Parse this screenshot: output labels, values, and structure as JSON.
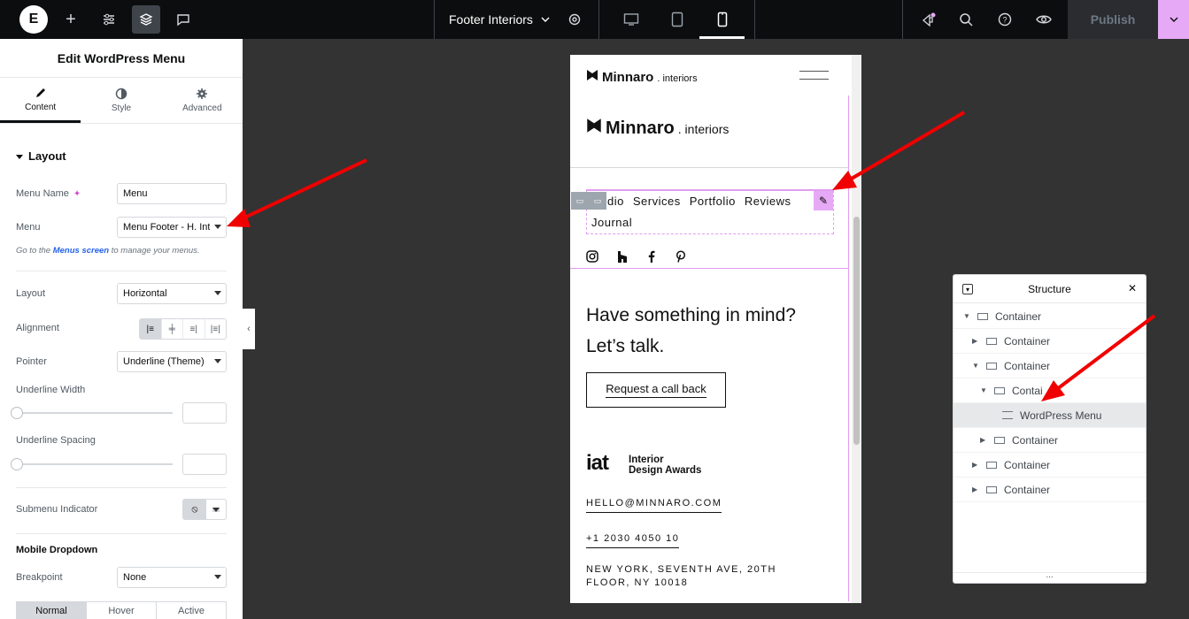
{
  "topbar": {
    "logo": "E",
    "document_title": "Footer Interiors",
    "publish_label": "Publish",
    "icons": [
      "add-icon",
      "settings-sliders-icon",
      "structure-layers-icon",
      "comments-icon",
      "site-settings-icon",
      "desktop-icon",
      "tablet-icon",
      "mobile-icon",
      "notifications-icon",
      "search-icon",
      "help-icon",
      "preview-eye-icon"
    ]
  },
  "panel": {
    "title": "Edit WordPress Menu",
    "tabs": [
      {
        "label": "Content",
        "icon": "pencil-icon"
      },
      {
        "label": "Style",
        "icon": "contrast-icon"
      },
      {
        "label": "Advanced",
        "icon": "gear-icon"
      }
    ],
    "section_layout": "Layout",
    "menu_name_label": "Menu Name",
    "menu_name_value": "Menu",
    "menu_label": "Menu",
    "menu_value": "Menu Footer - H. Interiors",
    "hint_prefix": "Go to the ",
    "hint_link": "Menus screen",
    "hint_suffix": " to manage your menus.",
    "layout_label": "Layout",
    "layout_value": "Horizontal",
    "alignment_label": "Alignment",
    "pointer_label": "Pointer",
    "pointer_value": "Underline (Theme)",
    "underline_width_label": "Underline Width",
    "underline_spacing_label": "Underline Spacing",
    "submenu_indicator_label": "Submenu Indicator",
    "mobile_dropdown_label": "Mobile Dropdown",
    "breakpoint_label": "Breakpoint",
    "breakpoint_value": "None",
    "state_tabs": [
      "Normal",
      "Hover",
      "Active"
    ]
  },
  "preview": {
    "brand_name": "Minnaro",
    "brand_suffix": ". interiors",
    "menu_items": [
      "dio",
      "Services",
      "Portfolio",
      "Reviews"
    ],
    "menu_item_wrap": "Journal",
    "social_icons": [
      "instagram-icon",
      "houzz-icon",
      "facebook-icon",
      "pinterest-icon"
    ],
    "headline_1": "Have something in mind?",
    "headline_2": "Let’s talk.",
    "cta_label": "Request a call back",
    "award_logo": "iat",
    "award_line1": "Interior",
    "award_line2": "Design Awards",
    "email": "HELLO@MINNARO.COM",
    "phone": "+1 2030 4050 10",
    "address_1": "NEW YORK, SEVENTH AVE, 20TH",
    "address_2": "FLOOR, NY 10018"
  },
  "structure": {
    "title": "Structure",
    "rows": [
      {
        "label": "Container"
      },
      {
        "label": "Container"
      },
      {
        "label": "Container"
      },
      {
        "label": "Contai"
      },
      {
        "label": "WordPress Menu"
      },
      {
        "label": "Container"
      },
      {
        "label": "Container"
      },
      {
        "label": "Container"
      }
    ]
  },
  "colors": {
    "topbar_bg": "#0c0d0e",
    "canvas_bg": "#333333",
    "accent_pink": "#e6a9f5",
    "arrow_red": "#f00000"
  }
}
